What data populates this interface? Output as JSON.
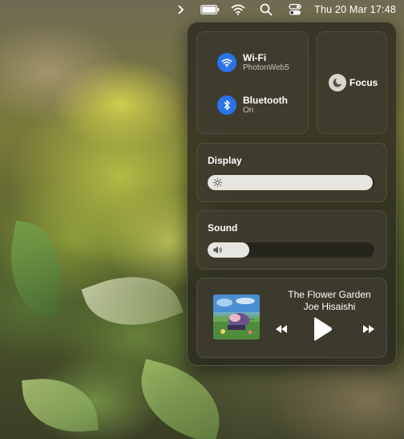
{
  "topbar": {
    "chevron_icon": "chevron-right-icon",
    "battery_icon": "battery-icon",
    "wifi_icon": "wifi-icon",
    "search_icon": "search-icon",
    "control_center_icon": "control-center-icon",
    "clock": "Thu 20 Mar  17:48"
  },
  "control_center": {
    "wifi": {
      "title": "Wi-Fi",
      "subtitle": "PhotonWeb5",
      "icon": "wifi-icon",
      "accent": "#2a73e8"
    },
    "bluetooth": {
      "title": "Bluetooth",
      "subtitle": "On",
      "icon": "bluetooth-icon",
      "accent": "#2a73e8"
    },
    "focus": {
      "label": "Focus",
      "icon": "moon-icon"
    },
    "display": {
      "title": "Display",
      "level": 0.99,
      "icon": "sun-icon"
    },
    "sound": {
      "title": "Sound",
      "level": 0.25,
      "icon": "speaker-icon"
    },
    "now_playing": {
      "title": "The Flower Garden",
      "artist": "Joe Hisaishi",
      "previous_icon": "rewind-icon",
      "play_icon": "play-icon",
      "next_icon": "fast-forward-icon"
    }
  }
}
